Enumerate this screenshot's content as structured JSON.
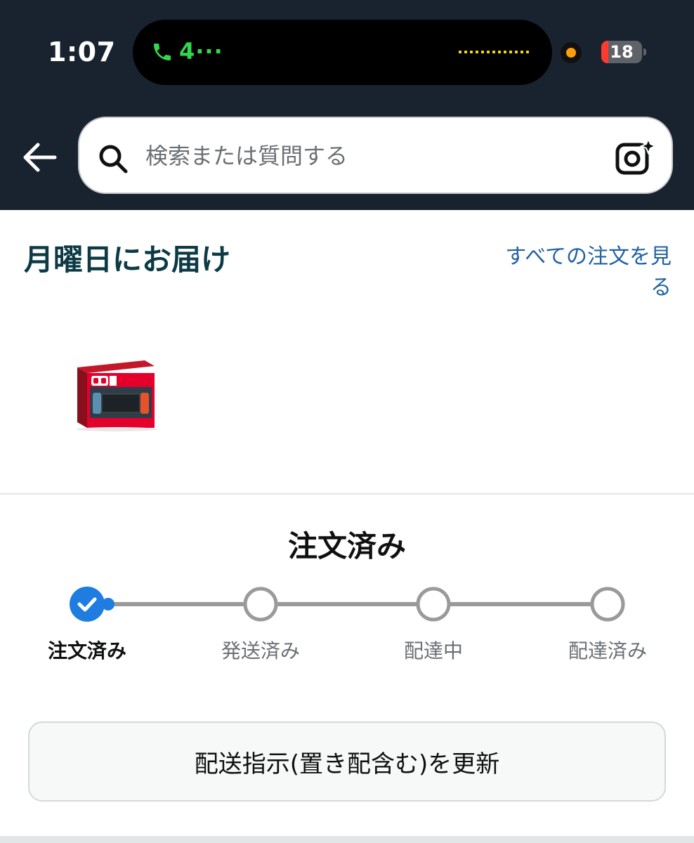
{
  "status_bar": {
    "time": "1:07",
    "call_text": "4···",
    "battery_level": "18",
    "battery_fraction": 0.18,
    "colors": {
      "call": "#32d74b",
      "waveform": "#f3e000",
      "mic_dot": "#ff9f0a",
      "battery_low": "#ff3b30"
    }
  },
  "header": {
    "search_placeholder": "検索または質問する",
    "icons": {
      "back": "arrow-left-icon",
      "search": "magnifier-icon",
      "lens": "camera-sparkle-icon"
    }
  },
  "delivery": {
    "title": "月曜日にお届け",
    "view_all_orders": "すべての注文を見る",
    "product_image": "Nintendo Switch 2 box"
  },
  "tracker": {
    "current_status": "注文済み",
    "steps": [
      {
        "label": "注文済み",
        "done": true
      },
      {
        "label": "発送済み",
        "done": false
      },
      {
        "label": "配達中",
        "done": false
      },
      {
        "label": "配達済み",
        "done": false
      }
    ],
    "colors": {
      "done": "#1f7ce0",
      "pending": "#9a9a9a"
    }
  },
  "actions": {
    "update_delivery_button": "配送指示(置き配含む)を更新"
  }
}
